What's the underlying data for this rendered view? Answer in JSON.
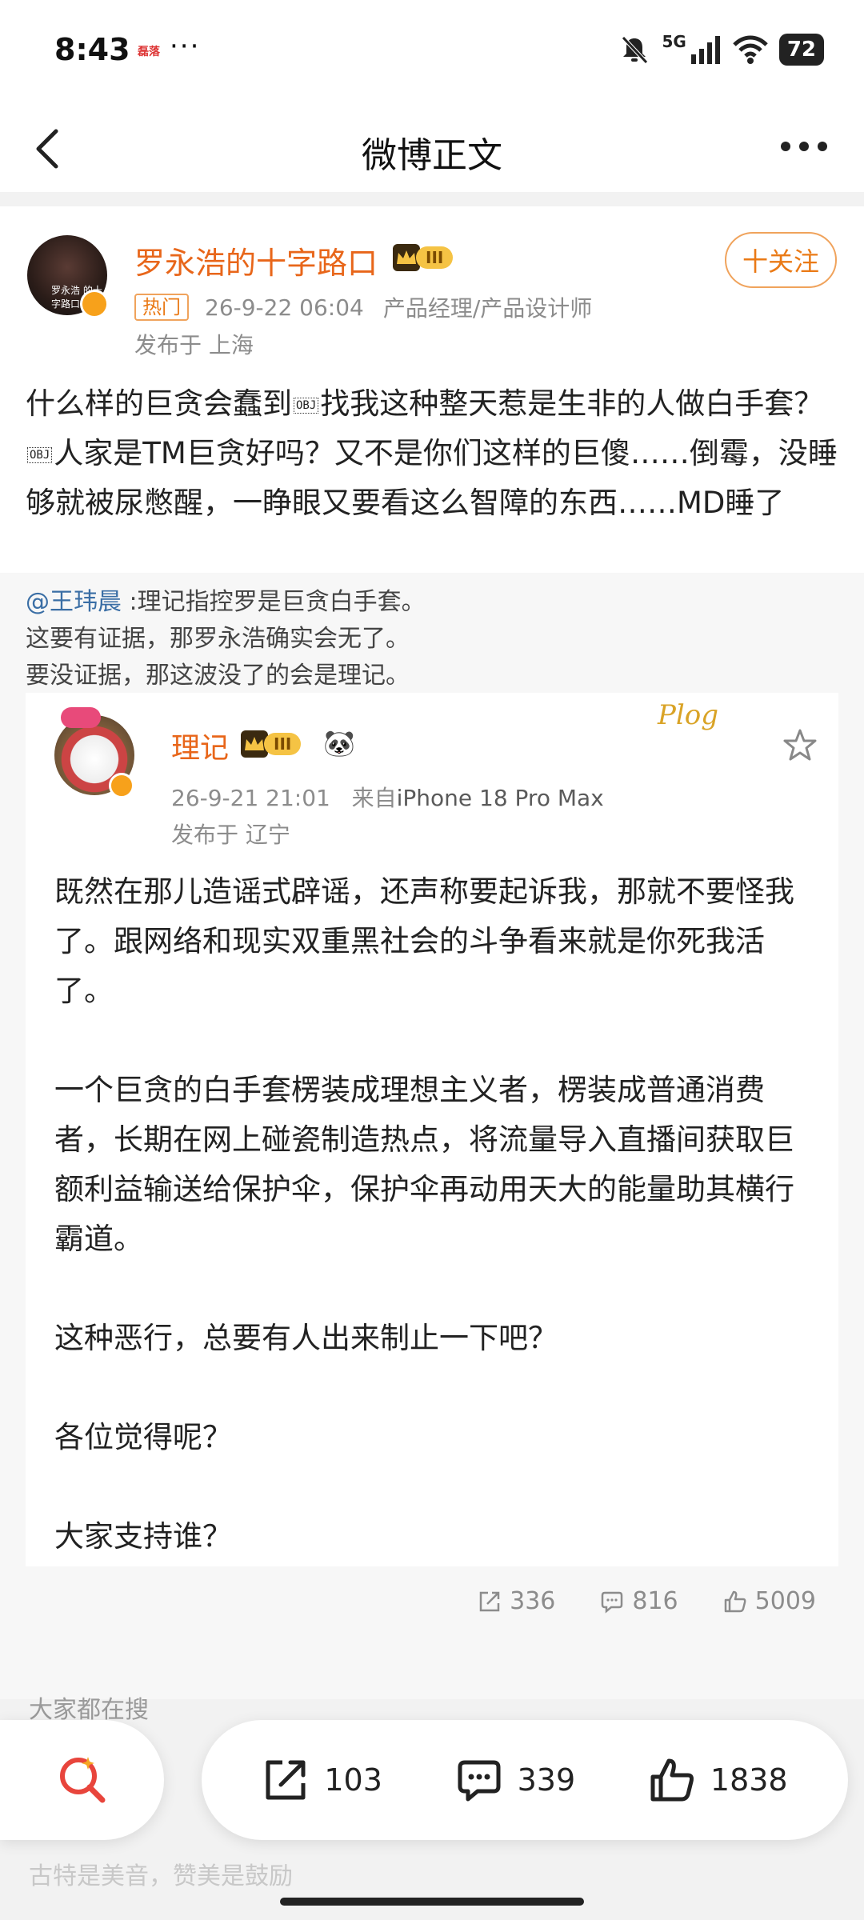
{
  "status_bar": {
    "time": "8:43",
    "notif": "磊落",
    "dots": "···",
    "network": "5G",
    "battery": "72"
  },
  "nav": {
    "title": "微博正文"
  },
  "post": {
    "author": "罗永浩的十字路口",
    "level": "III",
    "follow_label": "十关注",
    "hot_tag": "热门",
    "date": "26-9-22 06:04",
    "title": "产品经理/产品设计师",
    "location": "发布于 上海",
    "avatar_caption": "罗永浩 的十字路口",
    "text_part1": "什么样的巨贪会蠢到",
    "obj": "OBJ",
    "text_part2": "找我这种整天惹是生非的人做白手套？",
    "text_part3": "人家是TM巨贪好吗？又不是你们这样的巨傻……倒霉，没睡够就被尿憋醒，一睁眼又要看这么智障的东西……MD睡了"
  },
  "repost": {
    "mention": "@王玮晨",
    "quote_line1": ":理记指控罗是巨贪白手套。",
    "quote_line2": "这要有证据，那罗永浩确实会无了。",
    "quote_line3": "要没证据，那这波没了的会是理记。",
    "inner": {
      "author": "理记",
      "level": "III",
      "panda": "🐼",
      "sticker": "Plog",
      "date": "26-9-21 21:01",
      "source_prefix": "来自",
      "source": "iPhone 18 Pro Max",
      "location": "发布于 辽宁",
      "paragraphs": [
        "既然在那儿造谣式辟谣，还声称要起诉我，那就不要怪我了。跟网络和现实双重黑社会的斗争看来就是你死我活了。",
        "一个巨贪的白手套楞装成理想主义者，楞装成普通消费者，长期在网上碰瓷制造热点，将流量导入直播间获取巨额利益输送给保护伞，保护伞再动用天大的能量助其横行霸道。",
        "这种恶行，总要有人出来制止一下吧？",
        "各位觉得呢？",
        "大家支持谁？"
      ]
    },
    "actions": {
      "repost_count": "336",
      "comment_count": "816",
      "like_count": "5009"
    }
  },
  "search_hint": "大家都在搜",
  "faded_text": "古特是美音，赞美是鼓励",
  "bottom_bar": {
    "repost_count": "103",
    "comment_count": "339",
    "like_count": "1838"
  },
  "colors": {
    "accent_orange": "#e8661a",
    "link_blue": "#3a6ea5",
    "muted_gray": "#8c8c8c",
    "search_red": "#e8453c"
  }
}
